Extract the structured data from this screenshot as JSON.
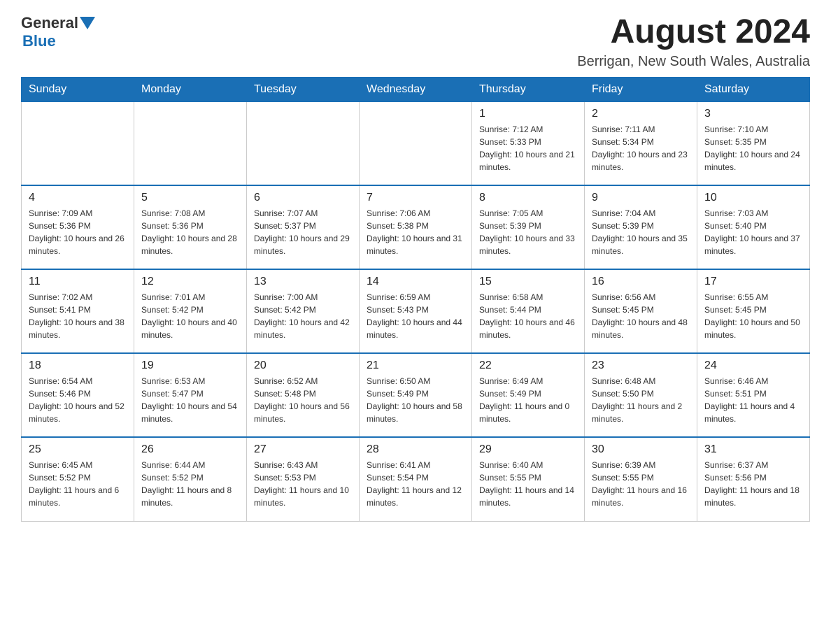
{
  "header": {
    "logo_general": "General",
    "logo_blue": "Blue",
    "title": "August 2024",
    "subtitle": "Berrigan, New South Wales, Australia"
  },
  "days_of_week": [
    "Sunday",
    "Monday",
    "Tuesday",
    "Wednesday",
    "Thursday",
    "Friday",
    "Saturday"
  ],
  "weeks": [
    {
      "cells": [
        {
          "day": "",
          "info": ""
        },
        {
          "day": "",
          "info": ""
        },
        {
          "day": "",
          "info": ""
        },
        {
          "day": "",
          "info": ""
        },
        {
          "day": "1",
          "info": "Sunrise: 7:12 AM\nSunset: 5:33 PM\nDaylight: 10 hours and 21 minutes."
        },
        {
          "day": "2",
          "info": "Sunrise: 7:11 AM\nSunset: 5:34 PM\nDaylight: 10 hours and 23 minutes."
        },
        {
          "day": "3",
          "info": "Sunrise: 7:10 AM\nSunset: 5:35 PM\nDaylight: 10 hours and 24 minutes."
        }
      ]
    },
    {
      "cells": [
        {
          "day": "4",
          "info": "Sunrise: 7:09 AM\nSunset: 5:36 PM\nDaylight: 10 hours and 26 minutes."
        },
        {
          "day": "5",
          "info": "Sunrise: 7:08 AM\nSunset: 5:36 PM\nDaylight: 10 hours and 28 minutes."
        },
        {
          "day": "6",
          "info": "Sunrise: 7:07 AM\nSunset: 5:37 PM\nDaylight: 10 hours and 29 minutes."
        },
        {
          "day": "7",
          "info": "Sunrise: 7:06 AM\nSunset: 5:38 PM\nDaylight: 10 hours and 31 minutes."
        },
        {
          "day": "8",
          "info": "Sunrise: 7:05 AM\nSunset: 5:39 PM\nDaylight: 10 hours and 33 minutes."
        },
        {
          "day": "9",
          "info": "Sunrise: 7:04 AM\nSunset: 5:39 PM\nDaylight: 10 hours and 35 minutes."
        },
        {
          "day": "10",
          "info": "Sunrise: 7:03 AM\nSunset: 5:40 PM\nDaylight: 10 hours and 37 minutes."
        }
      ]
    },
    {
      "cells": [
        {
          "day": "11",
          "info": "Sunrise: 7:02 AM\nSunset: 5:41 PM\nDaylight: 10 hours and 38 minutes."
        },
        {
          "day": "12",
          "info": "Sunrise: 7:01 AM\nSunset: 5:42 PM\nDaylight: 10 hours and 40 minutes."
        },
        {
          "day": "13",
          "info": "Sunrise: 7:00 AM\nSunset: 5:42 PM\nDaylight: 10 hours and 42 minutes."
        },
        {
          "day": "14",
          "info": "Sunrise: 6:59 AM\nSunset: 5:43 PM\nDaylight: 10 hours and 44 minutes."
        },
        {
          "day": "15",
          "info": "Sunrise: 6:58 AM\nSunset: 5:44 PM\nDaylight: 10 hours and 46 minutes."
        },
        {
          "day": "16",
          "info": "Sunrise: 6:56 AM\nSunset: 5:45 PM\nDaylight: 10 hours and 48 minutes."
        },
        {
          "day": "17",
          "info": "Sunrise: 6:55 AM\nSunset: 5:45 PM\nDaylight: 10 hours and 50 minutes."
        }
      ]
    },
    {
      "cells": [
        {
          "day": "18",
          "info": "Sunrise: 6:54 AM\nSunset: 5:46 PM\nDaylight: 10 hours and 52 minutes."
        },
        {
          "day": "19",
          "info": "Sunrise: 6:53 AM\nSunset: 5:47 PM\nDaylight: 10 hours and 54 minutes."
        },
        {
          "day": "20",
          "info": "Sunrise: 6:52 AM\nSunset: 5:48 PM\nDaylight: 10 hours and 56 minutes."
        },
        {
          "day": "21",
          "info": "Sunrise: 6:50 AM\nSunset: 5:49 PM\nDaylight: 10 hours and 58 minutes."
        },
        {
          "day": "22",
          "info": "Sunrise: 6:49 AM\nSunset: 5:49 PM\nDaylight: 11 hours and 0 minutes."
        },
        {
          "day": "23",
          "info": "Sunrise: 6:48 AM\nSunset: 5:50 PM\nDaylight: 11 hours and 2 minutes."
        },
        {
          "day": "24",
          "info": "Sunrise: 6:46 AM\nSunset: 5:51 PM\nDaylight: 11 hours and 4 minutes."
        }
      ]
    },
    {
      "cells": [
        {
          "day": "25",
          "info": "Sunrise: 6:45 AM\nSunset: 5:52 PM\nDaylight: 11 hours and 6 minutes."
        },
        {
          "day": "26",
          "info": "Sunrise: 6:44 AM\nSunset: 5:52 PM\nDaylight: 11 hours and 8 minutes."
        },
        {
          "day": "27",
          "info": "Sunrise: 6:43 AM\nSunset: 5:53 PM\nDaylight: 11 hours and 10 minutes."
        },
        {
          "day": "28",
          "info": "Sunrise: 6:41 AM\nSunset: 5:54 PM\nDaylight: 11 hours and 12 minutes."
        },
        {
          "day": "29",
          "info": "Sunrise: 6:40 AM\nSunset: 5:55 PM\nDaylight: 11 hours and 14 minutes."
        },
        {
          "day": "30",
          "info": "Sunrise: 6:39 AM\nSunset: 5:55 PM\nDaylight: 11 hours and 16 minutes."
        },
        {
          "day": "31",
          "info": "Sunrise: 6:37 AM\nSunset: 5:56 PM\nDaylight: 11 hours and 18 minutes."
        }
      ]
    }
  ]
}
